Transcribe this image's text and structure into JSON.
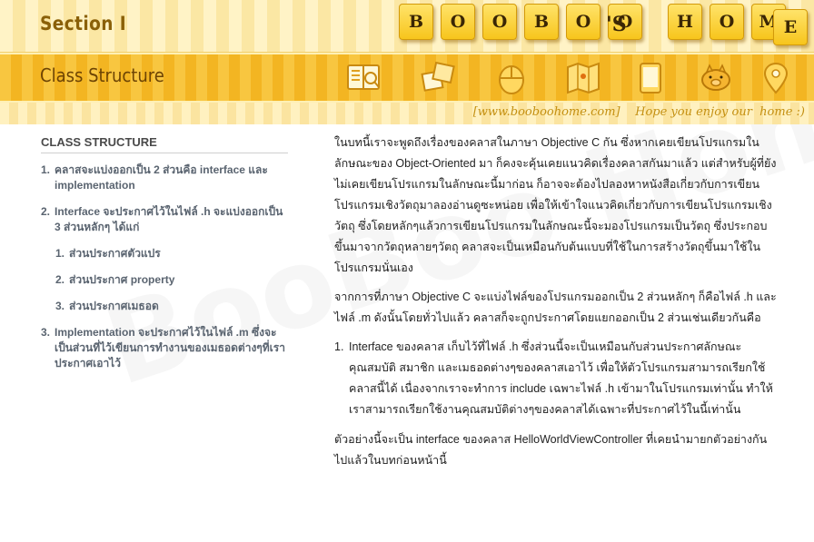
{
  "header": {
    "section_title": "Section I",
    "logo_letters": [
      "B",
      "O",
      "O",
      "B",
      "O",
      "O",
      "'S",
      "H",
      "O",
      "M",
      "E"
    ],
    "subsection_title": "Class Structure",
    "tagline": "[www.booboohome.com]    Hope you enjoy our  home :)",
    "nav_icons": [
      "book-icon",
      "photos-icon",
      "mouse-icon",
      "map-icon",
      "tablet-icon",
      "pig-icon",
      "location-pin-icon"
    ]
  },
  "sidebar": {
    "heading": "CLASS STRUCTURE",
    "items": [
      {
        "num": "1.",
        "text": "คลาสจะแบ่งออกเป็น 2 ส่วนคือ interface และ implementation",
        "level": 1
      },
      {
        "num": "2.",
        "text": "Interface จะประกาศไว้ในไฟล์ .h จะแบ่งออกเป็น 3 ส่วนหลักๆ ได้แก่",
        "level": 1
      },
      {
        "num": "1.",
        "text": "ส่วนประกาศตัวแปร",
        "level": 2
      },
      {
        "num": "2.",
        "text": "ส่วนประกาศ property",
        "level": 2
      },
      {
        "num": "3.",
        "text": "ส่วนประกาศเมธอด",
        "level": 2
      },
      {
        "num": "3.",
        "text": "Implementation จะประกาศไว้ในไฟล์ .m ซึ่งจะเป็นส่วนที่ไว้เขียนการทำงานของเมธอดต่างๆที่เราประกาศเอาไว้",
        "level": 1
      }
    ]
  },
  "article": {
    "p1": "ในบทนี้เราจะพูดถึงเรื่องของคลาสในภาษา Objective C กัน ซึ่งหากเคยเขียนโปรแกรมในลักษณะของ Object-Oriented มา ก็คงจะคุ้นเคยแนวคิดเรื่องคลาสกันมาแล้ว แต่สำหรับผู้ที่ยังไม่เคยเขียนโปรแกรมในลักษณะนี้มาก่อน ก็อาจจะต้องไปลองหาหนังสือเกี่ยวกับการเขียนโปรแกรมเชิงวัตถุมาลองอ่านดูซะหน่อย เพื่อให้เข้าใจแนวคิดเกี่ยวกับการเขียนโปรแกรมเชิงวัตถุ ซึ่งโดยหลักๆแล้วการเขียนโปรแกรมในลักษณะนี้จะมองโปรแกรมเป็นวัตถุ ซึ่งประกอบขึ้นมาจากวัตถุหลายๆวัตถุ คลาสจะเป็นเหมือนกับต้นแบบที่ใช้ในการสร้างวัตถุขึ้นมาใช้ในโปรแกรมนั่นเอง",
    "p2": "จากการที่ภาษา Objective C จะแบ่งไฟล์ของโปรแกรมออกเป็น 2 ส่วนหลักๆ ก็คือไฟล์ .h และไฟล์ .m ดังนั้นโดยทั่วไปแล้ว คลาสก็จะถูกประกาศโดยแยกออกเป็น 2 ส่วนเช่นเดียวกันคือ",
    "list": [
      {
        "num": "1.",
        "text": "Interface ของคลาส เก็บไว้ที่ไฟล์ .h ซึ่งส่วนนี้จะเป็นเหมือนกับส่วนประกาศลักษณะคุณสมบัติ สมาชิก และเมธอดต่างๆของคลาสเอาไว้ เพื่อให้ตัวโปรแกรมสามารถเรียกใช้คลาสนี้ได้ เนื่องจากเราจะทำการ include เฉพาะไฟล์ .h เข้ามาในโปรแกรมเท่านั้น ทำให้เราสามารถเรียกใช้งานคุณสมบัติต่างๆของคลาสได้เฉพาะที่ประกาศไว้ในนี้เท่านั้น"
      }
    ],
    "p3": "ตัวอย่างนี้จะเป็น interface ของคลาส HelloWorldViewController ที่เคยนำมายกตัวอย่างกันไปแล้วในบทก่อนหน้านี้"
  },
  "watermark": "BooBoo Home",
  "colors": {
    "accent": "#f3b522",
    "tile": "#f7c51c",
    "link": "#5a6470",
    "tagline": "#c49012"
  }
}
